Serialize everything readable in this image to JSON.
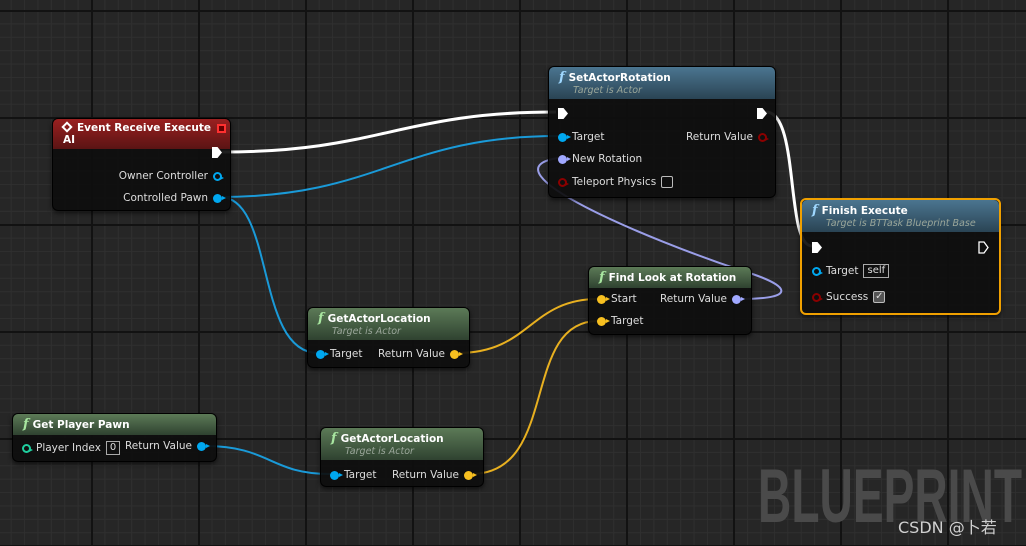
{
  "colors": {
    "exec": "#ffffff",
    "object": "#00a8f0",
    "vector": "#f8c020",
    "rotator": "#a0a8ff",
    "bool": "#8b0000",
    "int": "#1fcf9f",
    "selected": "#f0a000"
  },
  "watermark": "BLUEPRINT",
  "credit": "CSDN @卜若",
  "event_node": {
    "title": "Event Receive Execute AI",
    "icon": "event-diamond-icon",
    "pins": [
      "Owner Controller",
      "Controlled Pawn"
    ]
  },
  "set_rotation": {
    "title": "SetActorRotation",
    "subtitle": "Target is Actor",
    "pins": {
      "target": "Target",
      "new_rotation": "New Rotation",
      "teleport": "Teleport Physics",
      "return": "Return Value"
    },
    "teleport_checked": false
  },
  "finish": {
    "title": "Finish Execute",
    "subtitle": "Target is BTTask Blueprint Base",
    "pins": {
      "target": "Target",
      "target_value": "self",
      "success": "Success"
    },
    "success_checked": true
  },
  "find_look": {
    "title": "Find Look at Rotation",
    "pins": {
      "start": "Start",
      "target": "Target",
      "return": "Return Value"
    }
  },
  "get_loc1": {
    "title": "GetActorLocation",
    "subtitle": "Target is Actor",
    "pins": {
      "target": "Target",
      "return": "Return Value"
    }
  },
  "get_loc2": {
    "title": "GetActorLocation",
    "subtitle": "Target is Actor",
    "pins": {
      "target": "Target",
      "return": "Return Value"
    }
  },
  "player_pawn": {
    "title": "Get Player Pawn",
    "pins": {
      "index": "Player Index",
      "index_value": "0",
      "return": "Return Value"
    }
  }
}
